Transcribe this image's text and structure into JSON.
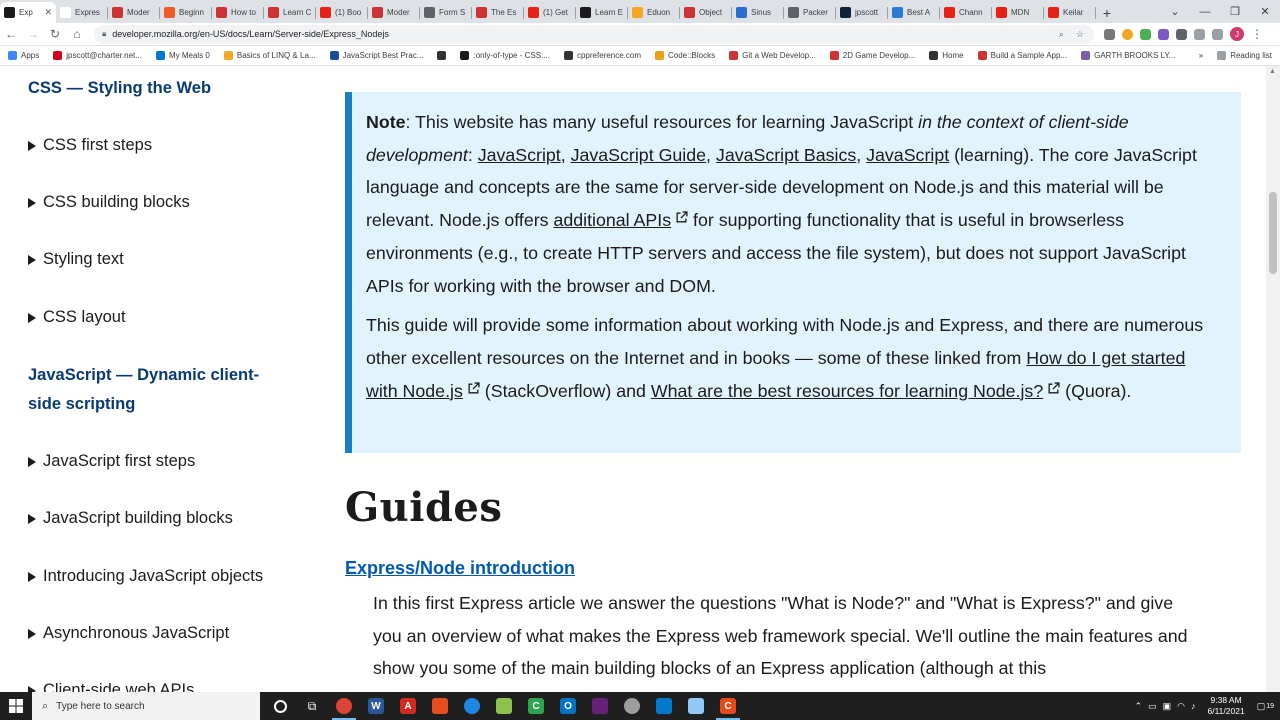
{
  "browser": {
    "tabs": [
      {
        "label": "Exp",
        "color": "#1b1b1b",
        "active": true
      },
      {
        "label": "Expres",
        "color": "#ffffff"
      },
      {
        "label": "Moder",
        "color": "#cc3333"
      },
      {
        "label": "Beginn",
        "color": "#f25a29"
      },
      {
        "label": "How to",
        "color": "#cc3333"
      },
      {
        "label": "Learn C",
        "color": "#cc3333"
      },
      {
        "label": "(1) Boo",
        "color": "#e62117"
      },
      {
        "label": "Moder",
        "color": "#cc3333"
      },
      {
        "label": "Form S",
        "color": "#5f6368"
      },
      {
        "label": "The Es",
        "color": "#cc3333"
      },
      {
        "label": "(1) Get",
        "color": "#e62117"
      },
      {
        "label": "Learn E",
        "color": "#1b1b1b"
      },
      {
        "label": "Eduon",
        "color": "#f5a623"
      },
      {
        "label": "Object",
        "color": "#cc3333"
      },
      {
        "label": "Sinus",
        "color": "#2b6cd4"
      },
      {
        "label": "Packer",
        "color": "#5f6368"
      },
      {
        "label": "jpscott",
        "color": "#0b2239"
      },
      {
        "label": "Best A",
        "color": "#2b7bd4"
      },
      {
        "label": "Chann",
        "color": "#e62117"
      },
      {
        "label": "MDN",
        "color": "#e62117"
      },
      {
        "label": "Keilar",
        "color": "#e62117"
      }
    ],
    "url": "developer.mozilla.org/en-US/docs/Learn/Server-side/Express_Nodejs",
    "bookmarks": [
      {
        "label": "Apps",
        "color": "#4285f4"
      },
      {
        "label": "jpscott@charter.net...",
        "color": "#d0021b"
      },
      {
        "label": "My Meals 0",
        "color": "#0078d4"
      },
      {
        "label": "Basics of LINQ & La...",
        "color": "#f5a623"
      },
      {
        "label": "JavaScript Best Prac...",
        "color": "#1b4f9c"
      },
      {
        "label": "",
        "color": "#333333"
      },
      {
        "label": ":only-of-type - CSS:...",
        "color": "#1b1b1b"
      },
      {
        "label": "cppreference.com",
        "color": "#333333"
      },
      {
        "label": "Code::Blocks",
        "color": "#e8a317"
      },
      {
        "label": "Git a Web Develop...",
        "color": "#cc3333"
      },
      {
        "label": "2D Game Develop...",
        "color": "#cc3333"
      },
      {
        "label": "Home",
        "color": "#333333"
      },
      {
        "label": "Build a Sample App...",
        "color": "#cc3333"
      },
      {
        "label": "GARTH BROOKS LY...",
        "color": "#7b5ea7"
      }
    ],
    "more": "»",
    "reading_list": "Reading list",
    "profile_initial": "J"
  },
  "sidebar": {
    "heading_css": "CSS — Styling the Web",
    "css_items": [
      "CSS first steps",
      "CSS building blocks",
      "Styling text",
      "CSS layout"
    ],
    "heading_js_1": "JavaScript — Dynamic client-",
    "heading_js_2": "side scripting",
    "js_items": [
      "JavaScript first steps",
      "JavaScript building blocks",
      "Introducing JavaScript objects",
      "Asynchronous JavaScript",
      "Client-side web APIs"
    ]
  },
  "note": {
    "bold": "Note",
    "t1": ": This website has many useful resources for learning JavaScript ",
    "italic": "in the context of client-side development",
    "t2": ": ",
    "link1": "JavaScript",
    "sep1": ", ",
    "link2": "JavaScript Guide",
    "sep2": ", ",
    "link3": "JavaScript Basics",
    "sep3": ", ",
    "link4": "JavaScript",
    "t3": " (learning). The core JavaScript language and concepts are the same for server-side development on Node.js and this material will be relevant. Node.js offers ",
    "link5": "additional APIs",
    "t4": " for supporting functionality that is useful in browserless environments (e.g., to create HTTP servers and access the file system), but does not support JavaScript APIs for working with the browser and DOM.",
    "p2_t1": "This guide will provide some information about working with Node.js and Express, and there are numerous other excellent resources on the Internet and in books — some of these linked from ",
    "p2_link1": "How do I get started with Node.js",
    "p2_t2": " (StackOverflow) and ",
    "p2_link2": "What are the best resources for learning Node.js?",
    "p2_t3": " (Quora)."
  },
  "guides": {
    "title": "Guides",
    "link": "Express/Node introduction",
    "desc": "In this first Express article we answer the questions \"What is Node?\" and \"What is Express?\" and give you an overview of what makes the Express web framework special. We'll outline the main features and show you some of the main building blocks of an Express application (although at this"
  },
  "taskbar": {
    "search_placeholder": "Type here to search",
    "time": "9:38 AM",
    "date": "6/11/2021",
    "notifications": "19"
  }
}
